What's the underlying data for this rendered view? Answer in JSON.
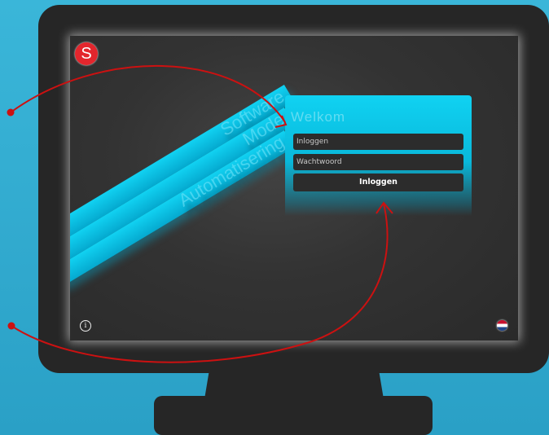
{
  "logo": {
    "letter": "S"
  },
  "stripes": [
    "Software",
    "Mode",
    "Automatisering"
  ],
  "login": {
    "title": "Welkom",
    "username_placeholder": "Inloggen",
    "password_placeholder": "Wachtwoord",
    "button_label": "Inloggen"
  },
  "footer": {
    "info_icon": "info-icon",
    "language_icon": "flag-netherlands-icon"
  },
  "colors": {
    "background": "#3ab6d9",
    "monitor": "#262626",
    "accent": "#10d2f2",
    "logo": "#e3262d",
    "annotation": "#cc1111"
  }
}
